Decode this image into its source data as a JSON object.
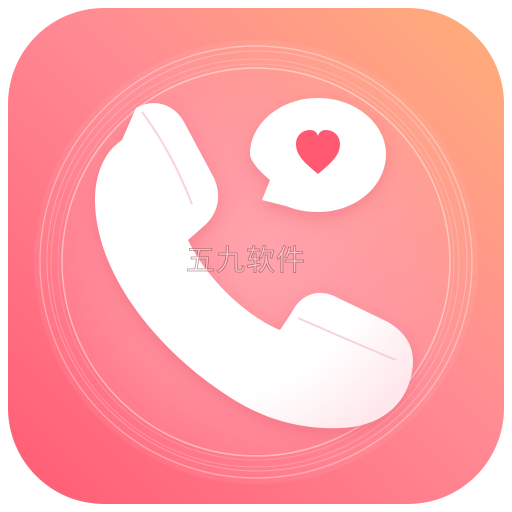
{
  "app_icon": {
    "icons": {
      "main": "phone-handset-icon",
      "badge": "heart-chat-bubble-icon"
    },
    "colors": {
      "gradient_top_right": "#FFAF78",
      "gradient_mid": "#FF8A93",
      "gradient_bottom_left": "#FF5C74",
      "heart": "#FF5A72",
      "handset": "#FFFFFF"
    },
    "watermark": {
      "text": "五九软件"
    }
  }
}
